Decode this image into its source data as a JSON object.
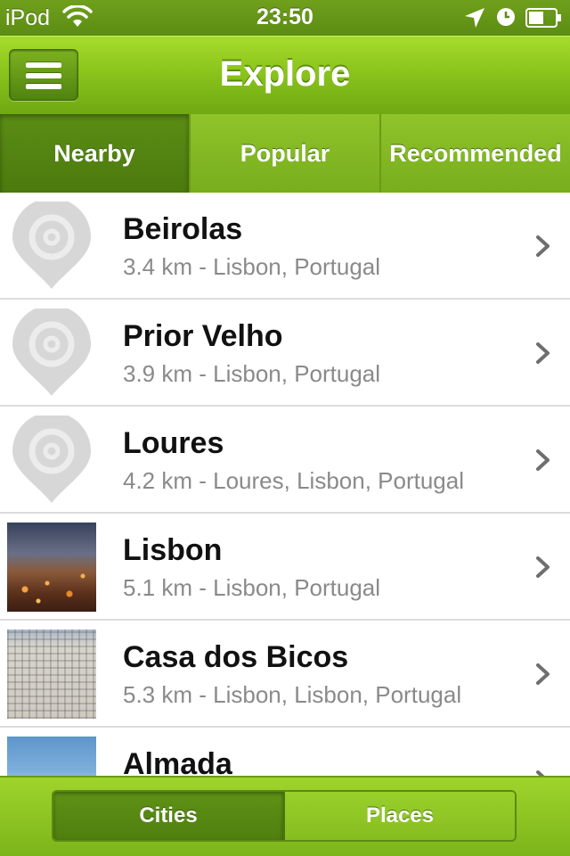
{
  "status_bar": {
    "carrier": "iPod",
    "time": "23:50",
    "icons": [
      "wifi-icon",
      "location-arrow-icon",
      "alarm-clock-icon",
      "battery-icon"
    ]
  },
  "nav": {
    "title": "Explore",
    "menu_icon": "hamburger-menu-icon"
  },
  "tabs": [
    {
      "label": "Nearby",
      "selected": true
    },
    {
      "label": "Popular",
      "selected": false
    },
    {
      "label": "Recommended",
      "selected": false
    }
  ],
  "places": [
    {
      "name": "Beirolas",
      "detail": "3.4 km - Lisbon, Portugal",
      "thumb": "map-pin-placeholder-icon"
    },
    {
      "name": "Prior Velho",
      "detail": "3.9 km - Lisbon, Portugal",
      "thumb": "map-pin-placeholder-icon"
    },
    {
      "name": "Loures",
      "detail": "4.2 km - Loures, Lisbon, Portugal",
      "thumb": "map-pin-placeholder-icon"
    },
    {
      "name": "Lisbon",
      "detail": "5.1 km - Lisbon, Portugal",
      "thumb": "photo-lisbon"
    },
    {
      "name": "Casa dos Bicos",
      "detail": "5.3 km - Lisbon, Lisbon, Portugal",
      "thumb": "photo-casa-dos-bicos"
    },
    {
      "name": "Almada",
      "detail": "",
      "thumb": "photo-almada"
    }
  ],
  "bottom": {
    "segments": [
      {
        "label": "Cities",
        "selected": true
      },
      {
        "label": "Places",
        "selected": false
      }
    ]
  },
  "colors": {
    "accent_green": "#8bc41c",
    "selected_green": "#4c7a0e",
    "primary_text": "#111111",
    "secondary_text": "#8a8a8a"
  }
}
